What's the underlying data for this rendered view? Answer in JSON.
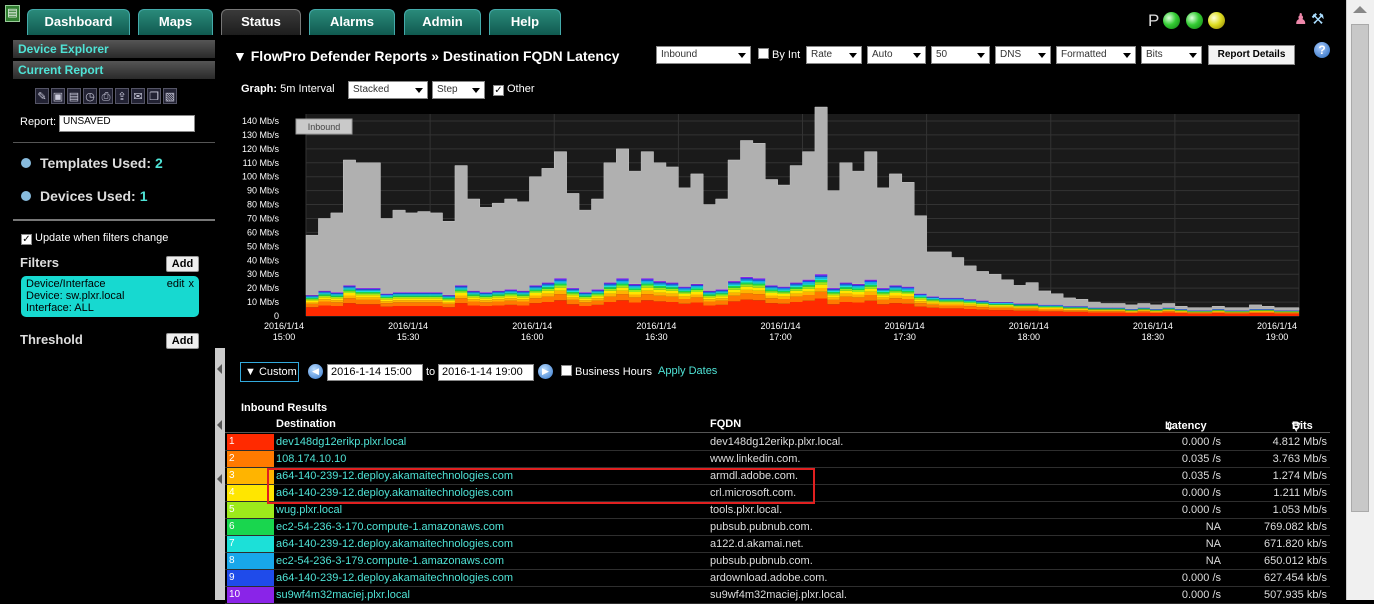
{
  "tabs": [
    {
      "label": "Dashboard",
      "active": false
    },
    {
      "label": "Maps",
      "active": false
    },
    {
      "label": "Status",
      "active": true
    },
    {
      "label": "Alarms",
      "active": false
    },
    {
      "label": "Admin",
      "active": false
    },
    {
      "label": "Help",
      "active": false
    }
  ],
  "status_indicator": {
    "label": "P",
    "lights": [
      "green",
      "green",
      "yellow"
    ]
  },
  "sidebar": {
    "device_explorer": "Device Explorer",
    "current_report": "Current Report",
    "report_label": "Report:",
    "report_value": "UNSAVED",
    "templates_label": "Templates Used:",
    "templates_count": "2",
    "devices_label": "Devices Used:",
    "devices_count": "1",
    "update_label": "Update when filters change",
    "filters_label": "Filters",
    "add_label": "Add",
    "filter_box": {
      "title": "Device/Interface",
      "edit": "edit",
      "remove": "x",
      "device": "Device: sw.plxr.local",
      "interface": "Interface: ALL"
    },
    "threshold_label": "Threshold"
  },
  "header": {
    "title": "▼ FlowPro Defender Reports » Destination FQDN Latency",
    "direction": "Inbound",
    "by_int": "By Int",
    "rate": "Rate",
    "auto": "Auto",
    "count": "50",
    "dns": "DNS",
    "formatted": "Formatted",
    "bits": "Bits",
    "report_details": "Report Details",
    "help": "?"
  },
  "graph_controls": {
    "graph_label": "Graph:",
    "interval": "5m Interval",
    "mode": "Stacked",
    "step": "Step",
    "other": "Other"
  },
  "chart_data": {
    "type": "area",
    "title": "",
    "legend": "Inbound",
    "y_ticks": [
      "0",
      "10 Mb/s",
      "20 Mb/s",
      "30 Mb/s",
      "40 Mb/s",
      "50 Mb/s",
      "60 Mb/s",
      "70 Mb/s",
      "80 Mb/s",
      "90 Mb/s",
      "100 Mb/s",
      "110 Mb/s",
      "120 Mb/s",
      "130 Mb/s",
      "140 Mb/s"
    ],
    "ylim": [
      0,
      145
    ],
    "x_ticks": [
      {
        "date": "2016/1/14",
        "time": "15:00"
      },
      {
        "date": "2016/1/14",
        "time": "15:30"
      },
      {
        "date": "2016/1/14",
        "time": "16:00"
      },
      {
        "date": "2016/1/14",
        "time": "16:30"
      },
      {
        "date": "2016/1/14",
        "time": "17:00"
      },
      {
        "date": "2016/1/14",
        "time": "17:30"
      },
      {
        "date": "2016/1/14",
        "time": "18:00"
      },
      {
        "date": "2016/1/14",
        "time": "18:30"
      },
      {
        "date": "2016/1/14",
        "time": "19:00"
      }
    ],
    "x_start": "2016-01-14 15:00",
    "x_end": "2016-01-14 19:00",
    "interval_minutes": 5,
    "series_colors": [
      "#ff2a00",
      "#ff7a00",
      "#ffb400",
      "#ffe600",
      "#9dea1b",
      "#19d64e",
      "#1ce0d8",
      "#18a7ea",
      "#1f4bea",
      "#8a24e8"
    ],
    "total": [
      58,
      70,
      74,
      112,
      110,
      110,
      70,
      76,
      74,
      75,
      74,
      68,
      108,
      84,
      78,
      81,
      84,
      82,
      100,
      106,
      118,
      88,
      76,
      84,
      110,
      120,
      104,
      118,
      110,
      107,
      92,
      102,
      80,
      84,
      112,
      126,
      124,
      98,
      94,
      108,
      118,
      150,
      90,
      110,
      104,
      118,
      92,
      102,
      96,
      72,
      46,
      46,
      42,
      36,
      32,
      30,
      26,
      22,
      24,
      18,
      16,
      13,
      12,
      10,
      9,
      9,
      8,
      9,
      8,
      9,
      7,
      6,
      6,
      7,
      6,
      6,
      8,
      7,
      6,
      6
    ],
    "colored": [
      15,
      18,
      17,
      22,
      20,
      20,
      16,
      17,
      17,
      17,
      17,
      15,
      22,
      18,
      17,
      18,
      19,
      18,
      22,
      24,
      27,
      20,
      17,
      19,
      24,
      27,
      23,
      27,
      25,
      24,
      21,
      23,
      18,
      19,
      25,
      28,
      27,
      22,
      21,
      24,
      26,
      30,
      20,
      24,
      23,
      26,
      20,
      22,
      21,
      16,
      14,
      13,
      13,
      12,
      11,
      10,
      10,
      9,
      9,
      8,
      8,
      7,
      7,
      6,
      6,
      6,
      5,
      6,
      5,
      6,
      5,
      4,
      4,
      5,
      4,
      4,
      5,
      5,
      4,
      4
    ]
  },
  "date_controls": {
    "range_label": "▼ Custom",
    "from": "2016-1-14 15:00",
    "to_label": "to",
    "to": "2016-1-14 19:00",
    "business_hours": "Business Hours",
    "apply": "Apply Dates"
  },
  "results": {
    "title": "Inbound Results",
    "columns": {
      "destination": "Destination",
      "fqdn": "FQDN",
      "latency": "Latency",
      "bits": "Bits"
    },
    "rows": [
      {
        "idx": "1",
        "color": "#ff2a00",
        "destination": "dev148dg12erikp.plxr.local",
        "fqdn": "dev148dg12erikp.plxr.local.",
        "latency": "0.000 /s",
        "bits": "4.812 Mb/s"
      },
      {
        "idx": "2",
        "color": "#ff7a00",
        "destination": "108.174.10.10",
        "fqdn": "www.linkedin.com.",
        "latency": "0.035 /s",
        "bits": "3.763 Mb/s"
      },
      {
        "idx": "3",
        "color": "#ffb400",
        "destination": "a64-140-239-12.deploy.akamaitechnologies.com",
        "fqdn": "armdl.adobe.com.",
        "latency": "0.035 /s",
        "bits": "1.274 Mb/s"
      },
      {
        "idx": "4",
        "color": "#ffe600",
        "destination": "a64-140-239-12.deploy.akamaitechnologies.com",
        "fqdn": "crl.microsoft.com.",
        "latency": "0.000 /s",
        "bits": "1.211 Mb/s"
      },
      {
        "idx": "5",
        "color": "#9dea1b",
        "destination": "wug.plxr.local",
        "fqdn": "tools.plxr.local.",
        "latency": "0.000 /s",
        "bits": "1.053 Mb/s"
      },
      {
        "idx": "6",
        "color": "#19d64e",
        "destination": "ec2-54-236-3-170.compute-1.amazonaws.com",
        "fqdn": "pubsub.pubnub.com.",
        "latency": "NA",
        "bits": "769.082 kb/s"
      },
      {
        "idx": "7",
        "color": "#1ce0d8",
        "destination": "a64-140-239-12.deploy.akamaitechnologies.com",
        "fqdn": "a122.d.akamai.net.",
        "latency": "NA",
        "bits": "671.820 kb/s"
      },
      {
        "idx": "8",
        "color": "#18a7ea",
        "destination": "ec2-54-236-3-179.compute-1.amazonaws.com",
        "fqdn": "pubsub.pubnub.com.",
        "latency": "NA",
        "bits": "650.012 kb/s"
      },
      {
        "idx": "9",
        "color": "#1f4bea",
        "destination": "a64-140-239-12.deploy.akamaitechnologies.com",
        "fqdn": "ardownload.adobe.com.",
        "latency": "0.000 /s",
        "bits": "627.454 kb/s"
      },
      {
        "idx": "10",
        "color": "#8a24e8",
        "destination": "su9wf4m32maciej.plxr.local",
        "fqdn": "su9wf4m32maciej.plxr.local.",
        "latency": "0.000 /s",
        "bits": "507.935 kb/s"
      }
    ]
  }
}
